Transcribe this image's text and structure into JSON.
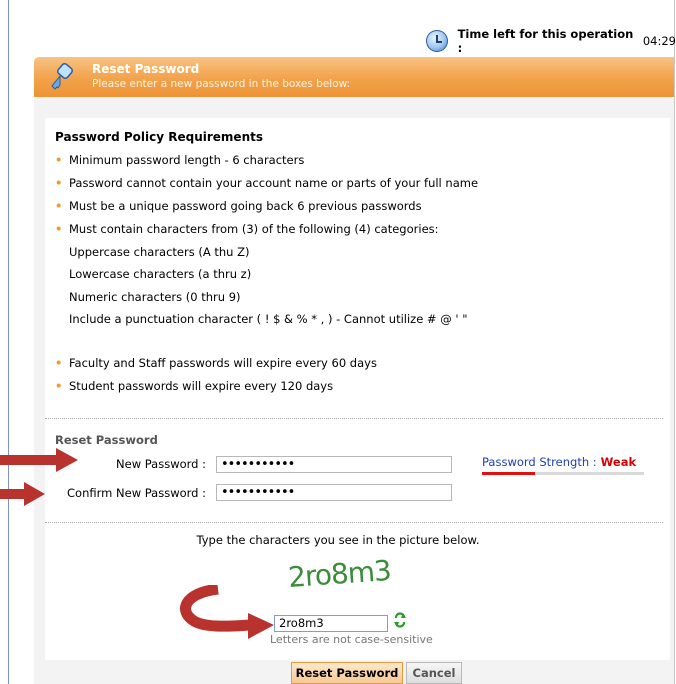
{
  "timer": {
    "label": "Time left for this operation :",
    "value": "04:29"
  },
  "header": {
    "title": "Reset Password",
    "subtitle": "Please enter a new password in the boxes below:"
  },
  "policy": {
    "title": "Password Policy Requirements",
    "bullets": [
      "Minimum password length - 6 characters",
      "Password cannot contain your account name or parts of your full name",
      "Must be a unique password going back 6 previous passwords",
      "Must contain characters from (3) of the following (4) categories:"
    ],
    "categories": [
      "Uppercase characters (A thu Z)",
      "Lowercase characters (a thru z)",
      "Numeric characters (0 thru 9)",
      "Include a punctuation character ( ! $ & % * , ) - Cannot utilize # @ ' \""
    ],
    "expiry": [
      "Faculty and Staff passwords will expire every 60 days",
      "Student passwords will expire every 120 days"
    ]
  },
  "form": {
    "section_title": "Reset Password",
    "new_password_label": "New Password :",
    "new_password_value": "•••••••••••",
    "confirm_password_label": "Confirm New Password :",
    "confirm_password_value": "•••••••••••",
    "strength_label": "Password Strength :",
    "strength_value": "Weak",
    "strength_fraction": 0.33
  },
  "captcha": {
    "instruction": "Type the characters you see in the picture below.",
    "image_text": "2ro8m3",
    "input_value": "2ro8m3",
    "note": "Letters are not case-sensitive"
  },
  "buttons": {
    "reset": "Reset Password",
    "cancel": "Cancel"
  },
  "colors": {
    "header_orange": "#f2a24a",
    "bullet_orange": "#f29a32",
    "strength_red": "#d60000",
    "arrow_red": "#b8332d",
    "captcha_green": "#3c8c3c"
  }
}
